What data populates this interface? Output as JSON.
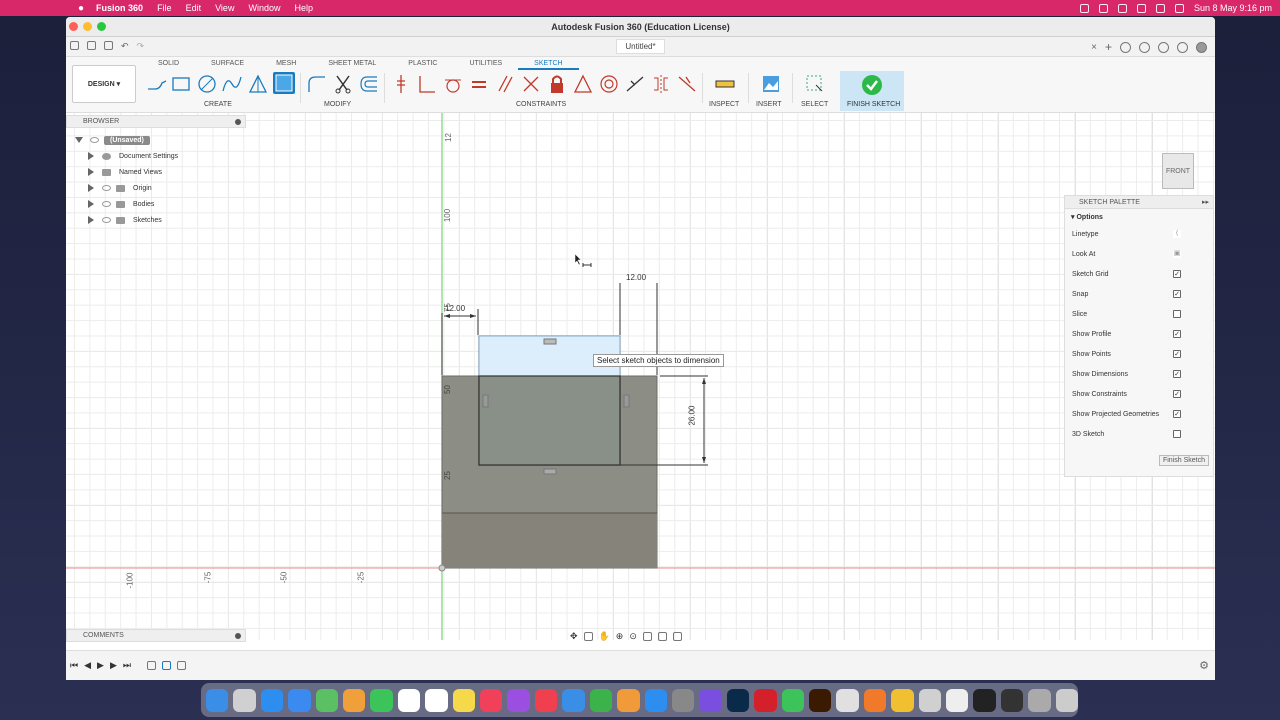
{
  "menubar": {
    "apple": "",
    "app": "Fusion 360",
    "items": [
      "File",
      "Edit",
      "View",
      "Window",
      "Help"
    ],
    "datetime": "Sun 8 May  9:16 pm",
    "color": "#d8286a"
  },
  "window": {
    "title": "Autodesk Fusion 360 (Education License)"
  },
  "document": {
    "name": "Untitled*"
  },
  "toolbar": {
    "workspace": "DESIGN",
    "tabs": [
      "SOLID",
      "SURFACE",
      "MESH",
      "SHEET METAL",
      "PLASTIC",
      "UTILITIES",
      "SKETCH"
    ],
    "active_tab": "SKETCH",
    "groups": {
      "create": "CREATE",
      "modify": "MODIFY",
      "constraints": "CONSTRAINTS",
      "inspect": "INSPECT",
      "insert": "INSERT",
      "select": "SELECT",
      "finish": "FINISH SKETCH"
    }
  },
  "browser": {
    "title": "BROWSER",
    "root": "(Unsaved)",
    "items": [
      "Document Settings",
      "Named Views",
      "Origin",
      "Bodies",
      "Sketches"
    ]
  },
  "viewcube": {
    "face": "FRONT"
  },
  "tooltip": "Select sketch objects to dimension",
  "dimensions": {
    "top": "12.00",
    "right": "26.00",
    "partial": "12.00"
  },
  "axis_labels": {
    "vertical": [
      "12",
      "100",
      "75",
      "50",
      "25"
    ],
    "horizontal": [
      "-100",
      "-75",
      "-50",
      "-25"
    ]
  },
  "palette": {
    "title": "SKETCH PALETTE",
    "section": "Options",
    "rows": [
      {
        "label": "Linetype",
        "checked": null
      },
      {
        "label": "Look At",
        "checked": null
      },
      {
        "label": "Sketch Grid",
        "checked": true
      },
      {
        "label": "Snap",
        "checked": true
      },
      {
        "label": "Slice",
        "checked": false
      },
      {
        "label": "Show Profile",
        "checked": true
      },
      {
        "label": "Show Points",
        "checked": true
      },
      {
        "label": "Show Dimensions",
        "checked": true
      },
      {
        "label": "Show Constraints",
        "checked": true
      },
      {
        "label": "Show Projected Geometries",
        "checked": true
      },
      {
        "label": "3D Sketch",
        "checked": false
      }
    ],
    "finish_button": "Finish Sketch"
  },
  "comments": {
    "title": "COMMENTS"
  },
  "dock": {
    "apps": [
      {
        "name": "finder",
        "color": "#3a8ee6"
      },
      {
        "name": "launchpad",
        "color": "#d0d0d0"
      },
      {
        "name": "safari",
        "color": "#2d8ef0"
      },
      {
        "name": "mail",
        "color": "#3b8af0"
      },
      {
        "name": "maps",
        "color": "#5bbf63"
      },
      {
        "name": "photos",
        "color": "#f0a03a"
      },
      {
        "name": "facetime",
        "color": "#3cc35a"
      },
      {
        "name": "calendar",
        "color": "#ffffff"
      },
      {
        "name": "reminders",
        "color": "#ffffff"
      },
      {
        "name": "notes",
        "color": "#f6d94a"
      },
      {
        "name": "music",
        "color": "#f0405a"
      },
      {
        "name": "podcasts",
        "color": "#9b4fe0"
      },
      {
        "name": "news",
        "color": "#f04050"
      },
      {
        "name": "keynote",
        "color": "#3a8ee6"
      },
      {
        "name": "numbers",
        "color": "#3cb34a"
      },
      {
        "name": "pages",
        "color": "#f09a3a"
      },
      {
        "name": "app-store",
        "color": "#2d8ef0"
      },
      {
        "name": "system-preferences",
        "color": "#888888"
      },
      {
        "name": "shortcuts",
        "color": "#7a4fe0"
      },
      {
        "name": "photoshop",
        "color": "#0a2a4a"
      },
      {
        "name": "acrobat",
        "color": "#d4202a"
      },
      {
        "name": "whatsapp",
        "color": "#3cc35a"
      },
      {
        "name": "illustrator",
        "color": "#3a1a00"
      },
      {
        "name": "sonos",
        "color": "#e0e0e0"
      },
      {
        "name": "fusion",
        "color": "#f07a2a"
      },
      {
        "name": "chrome",
        "color": "#f0c030"
      },
      {
        "name": "help",
        "color": "#d0d0d0"
      },
      {
        "name": "preview",
        "color": "#eeeeee"
      },
      {
        "name": "terminal",
        "color": "#222222"
      },
      {
        "name": "terminal-2",
        "color": "#333333"
      },
      {
        "name": "files",
        "color": "#aaaaaa"
      },
      {
        "name": "trash",
        "color": "#cccccc"
      }
    ]
  }
}
